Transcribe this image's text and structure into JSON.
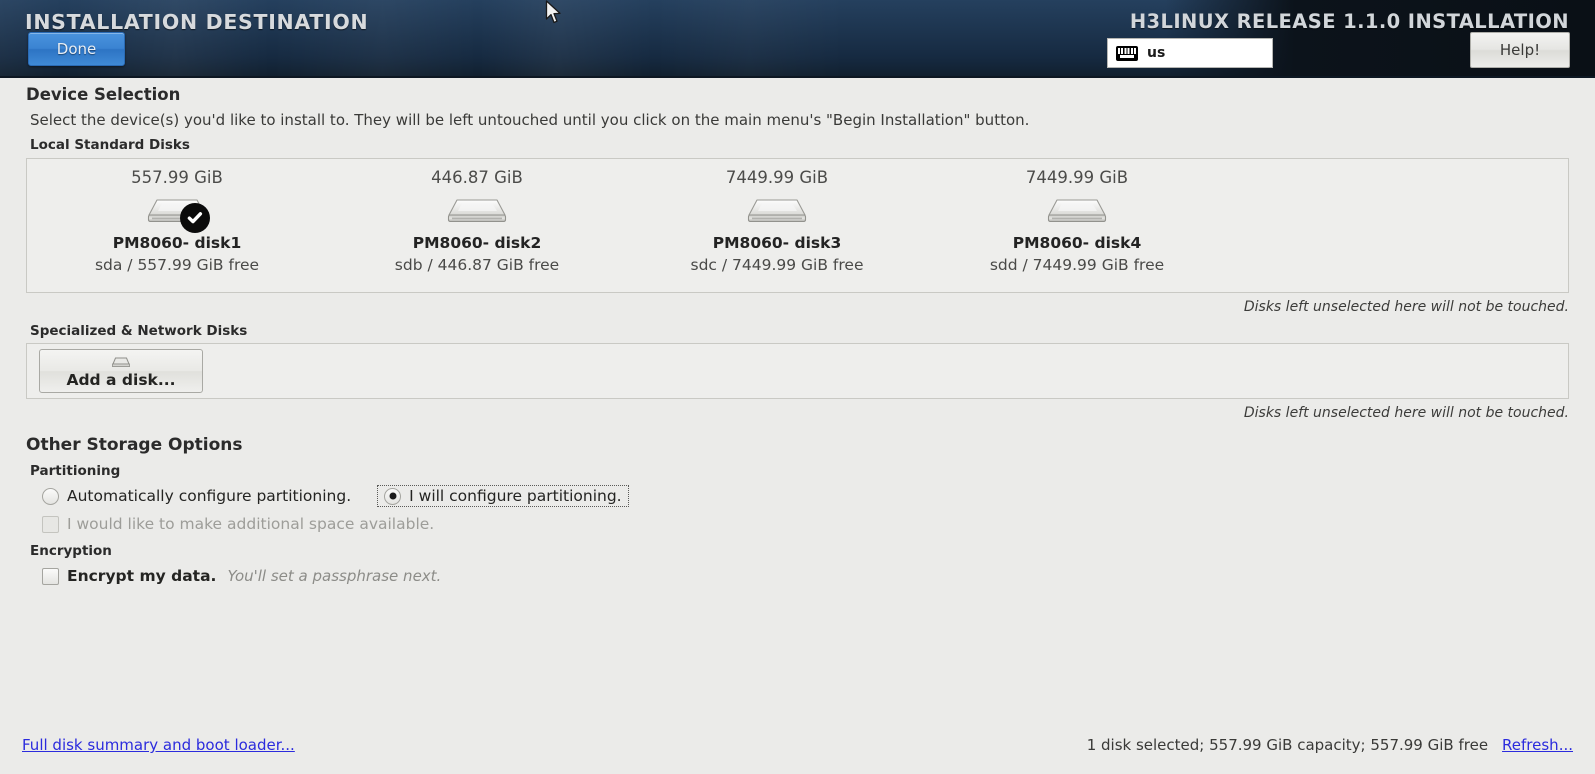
{
  "header": {
    "title": "INSTALLATION DESTINATION",
    "done_label": "Done",
    "release": "H3LINUX RELEASE 1.1.0 INSTALLATION",
    "keyboard_layout": "us",
    "keyboard_icon": "keyboard-icon",
    "help_label": "Help!",
    "accent_blue": "#3a83d2",
    "background": "#16283d"
  },
  "device_selection": {
    "title": "Device Selection",
    "description": "Select the device(s) you'd like to install to.  They will be left untouched until you click on the main menu's \"Begin Installation\" button.",
    "local_disks_title": "Local Standard Disks",
    "disks": [
      {
        "capacity": "557.99 GiB",
        "name": "PM8060- disk1",
        "free": "sda / 557.99 GiB free",
        "device": "sda",
        "selected": true
      },
      {
        "capacity": "446.87 GiB",
        "name": "PM8060- disk2",
        "free": "sdb / 446.87 GiB free",
        "device": "sdb",
        "selected": false
      },
      {
        "capacity": "7449.99 GiB",
        "name": "PM8060- disk3",
        "free": "sdc / 7449.99 GiB free",
        "device": "sdc",
        "selected": false
      },
      {
        "capacity": "7449.99 GiB",
        "name": "PM8060- disk4",
        "free": "sdd / 7449.99 GiB free",
        "device": "sdd",
        "selected": false
      }
    ],
    "local_hint": "Disks left unselected here will not be touched.",
    "specialized_title": "Specialized & Network Disks",
    "add_disk_label": "Add a disk...",
    "add_disk_icon": "disk-icon",
    "specialized_hint": "Disks left unselected here will not be touched."
  },
  "other_storage": {
    "title": "Other Storage Options",
    "partitioning": {
      "title": "Partitioning",
      "auto_label": "Automatically configure partitioning.",
      "auto_selected": false,
      "manual_label": "I will configure partitioning.",
      "manual_selected": true,
      "manual_focused": true,
      "reclaim_label": "I would like to make additional space available.",
      "reclaim_checked": false,
      "reclaim_disabled": true
    },
    "encryption": {
      "title": "Encryption",
      "encrypt_label": "Encrypt my data.",
      "encrypt_note": "You'll set a passphrase next.",
      "encrypt_checked": false
    }
  },
  "footer": {
    "summary_link": "Full disk summary and boot loader...",
    "status": "1 disk selected; 557.99 GiB capacity; 557.99 GiB free",
    "refresh_link": "Refresh...",
    "link_color": "#2b2bdd"
  }
}
